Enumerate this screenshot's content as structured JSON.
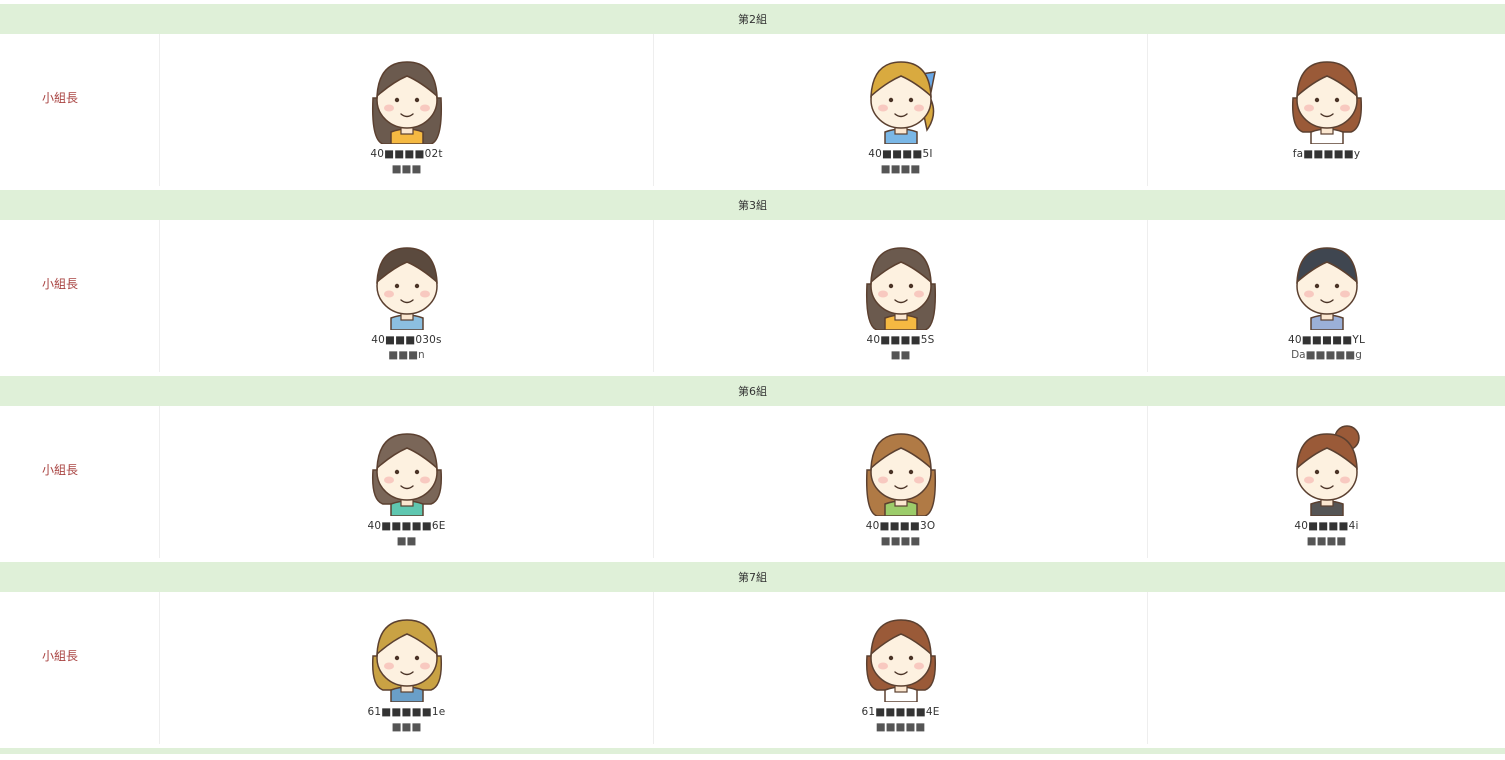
{
  "groups": [
    {
      "name": "第2組",
      "role": "小組長",
      "members": [
        {
          "id": "40■■■■02t",
          "name": "■■■",
          "hair": "#6b5a4e",
          "shirt": "#f5b942",
          "style": "long"
        },
        {
          "id": "40■■■■5I",
          "name": "■■■■",
          "hair": "#d9aa3f",
          "shirt": "#7ab7e6",
          "style": "ponytail"
        },
        {
          "id": "fa■■■■■y",
          "name": "",
          "hair": "#9a5a38",
          "shirt": "#ffffff",
          "style": "bob"
        }
      ]
    },
    {
      "name": "第3組",
      "role": "小組長",
      "members": [
        {
          "id": "40■■■030s",
          "name": "■■■n",
          "hair": "#5b4a3e",
          "shirt": "#8cbfe0",
          "style": "boy"
        },
        {
          "id": "40■■■■5S",
          "name": "■■",
          "hair": "#6b5a4e",
          "shirt": "#f5b942",
          "style": "long"
        },
        {
          "id": "40■■■■■YL",
          "name": "Da■■■■■g",
          "hair": "#3f4650",
          "shirt": "#9bb0d8",
          "style": "side"
        }
      ]
    },
    {
      "name": "第6組",
      "role": "小組長",
      "members": [
        {
          "id": "40■■■■■6E",
          "name": "■■",
          "hair": "#7a6658",
          "shirt": "#5fc7b0",
          "style": "medium"
        },
        {
          "id": "40■■■■3O",
          "name": "■■■■",
          "hair": "#b07a45",
          "shirt": "#9ccc6a",
          "style": "wavy"
        },
        {
          "id": "40■■■■4i",
          "name": "■■■■",
          "hair": "#9a5a38",
          "shirt": "#555555",
          "style": "bun"
        }
      ]
    },
    {
      "name": "第7組",
      "role": "小組長",
      "members": [
        {
          "id": "61■■■■■1e",
          "name": "■■■",
          "hair": "#c9a244",
          "shirt": "#6a9fc8",
          "style": "bob2"
        },
        {
          "id": "61■■■■■4E",
          "name": "■■■■■",
          "hair": "#9a5a38",
          "shirt": "#ffffff",
          "style": "bob"
        }
      ]
    }
  ]
}
